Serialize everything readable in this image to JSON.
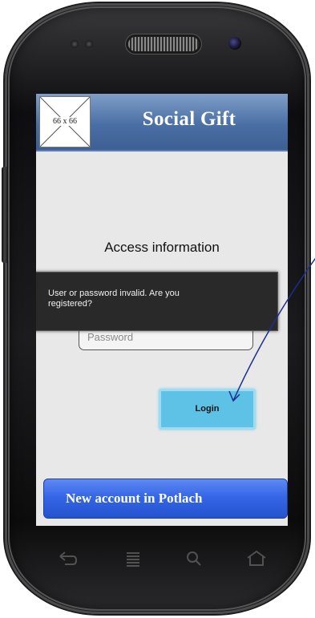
{
  "app": {
    "title": "Social Gift",
    "logo_placeholder": "66 x 66"
  },
  "login": {
    "heading": "Access information",
    "password_placeholder": "Password",
    "login_label": "Login"
  },
  "toast": {
    "message": "User or password invalid. Are you registered?"
  },
  "footer": {
    "new_account_label": "New account in Potlach"
  },
  "nav": {
    "icons": [
      "back-icon",
      "menu-icon",
      "search-icon",
      "home-icon"
    ]
  },
  "colors": {
    "header": "#4a6fa5",
    "login_button": "#5ec2e6",
    "new_account_button": "#3566e6",
    "annotation_arrow": "#1b2f8f"
  }
}
